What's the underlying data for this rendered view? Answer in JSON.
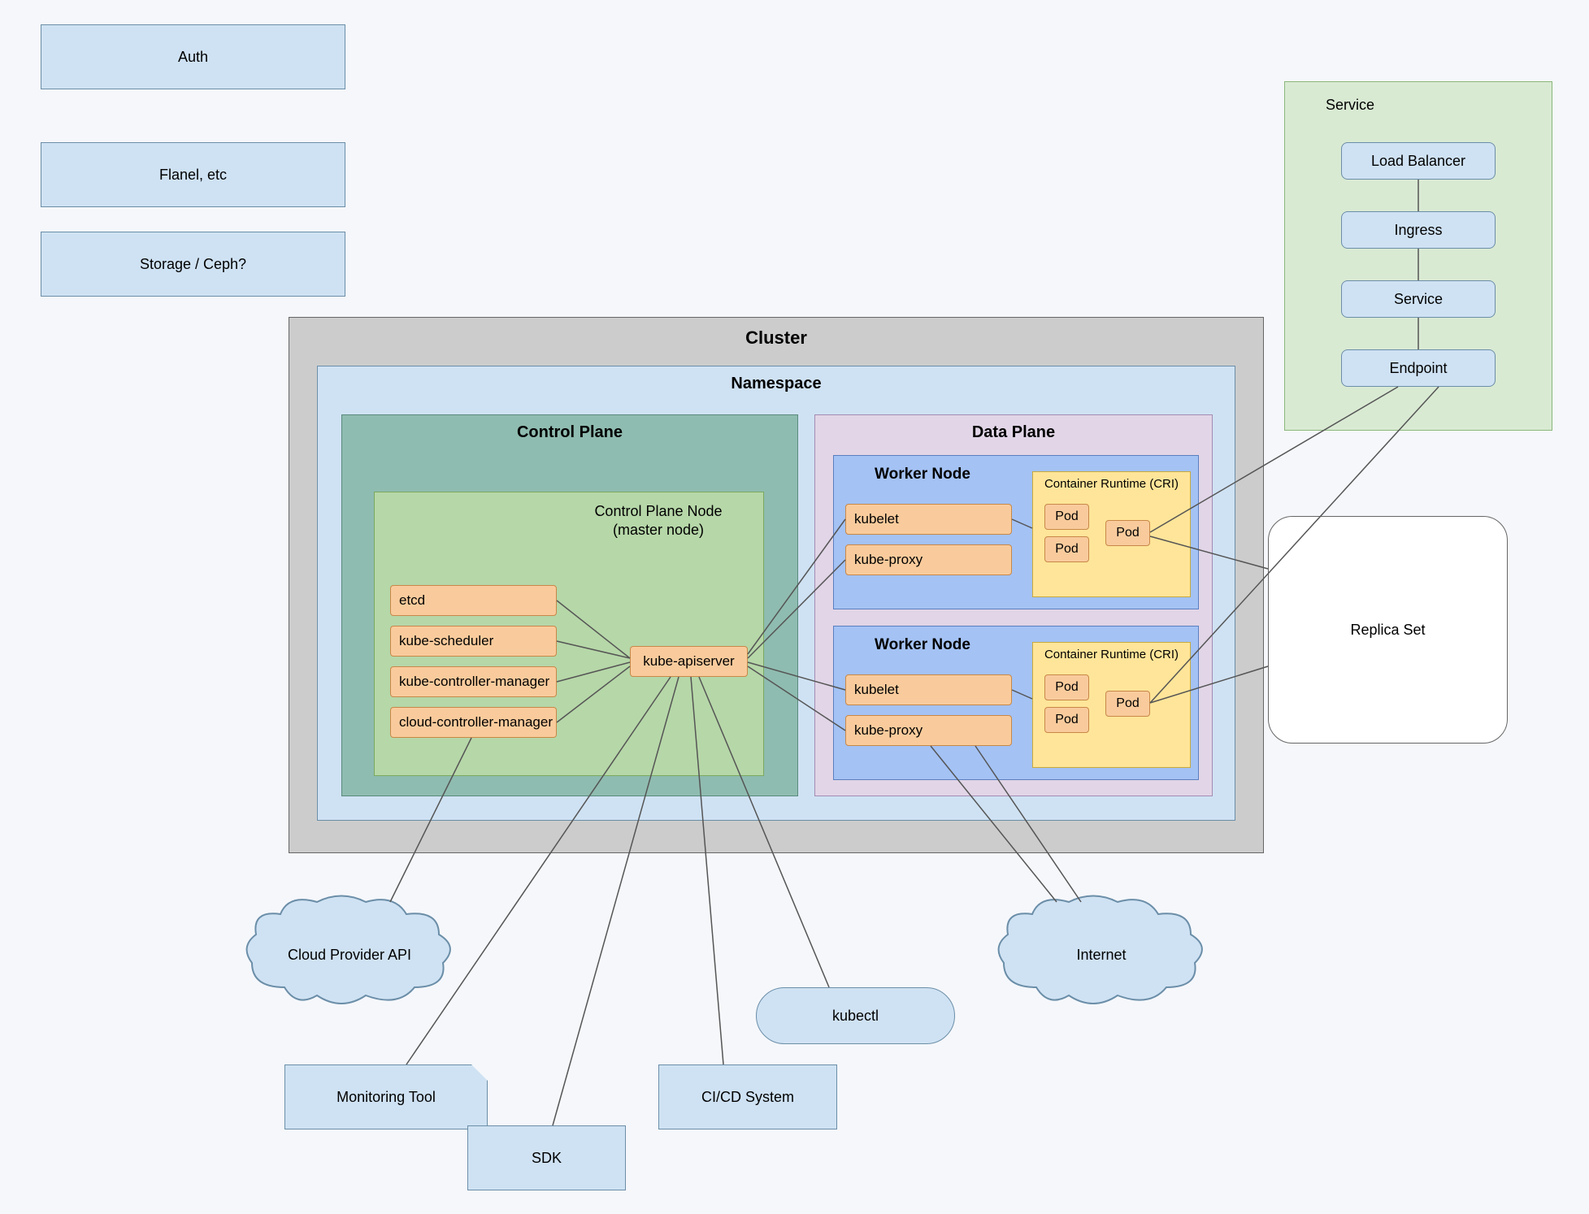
{
  "aux": {
    "auth": "Auth",
    "flanel": "Flanel, etc",
    "storage": "Storage / Ceph?"
  },
  "cluster": {
    "title": "Cluster"
  },
  "namespace": {
    "title": "Namespace"
  },
  "controlPlane": {
    "title": "Control Plane"
  },
  "dataPlane": {
    "title": "Data Plane"
  },
  "cpNode": {
    "title_l1": "Control Plane Node",
    "title_l2": "(master node)"
  },
  "cp": {
    "etcd": "etcd",
    "sched": "kube-scheduler",
    "kcm": "kube-controller-manager",
    "ccm": "cloud-controller-manager",
    "api": "kube-apiserver"
  },
  "wn": {
    "title": "Worker Node",
    "kubelet": "kubelet",
    "proxy": "kube-proxy",
    "cri": "Container Runtime (CRI)",
    "pod": "Pod"
  },
  "service": {
    "title": "Service",
    "lb": "Load Balancer",
    "ingress": "Ingress",
    "svc": "Service",
    "ep": "Endpoint"
  },
  "rs": {
    "title": "Replica Set"
  },
  "ext": {
    "cpa": "Cloud Provider API",
    "mon": "Monitoring Tool",
    "sdk": "SDK",
    "cicd": "CI/CD System",
    "kubectl": "kubectl",
    "internet": "Internet"
  }
}
